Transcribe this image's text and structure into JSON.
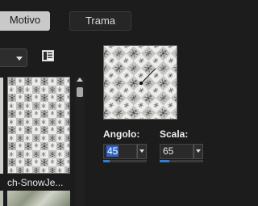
{
  "tabs": [
    {
      "label": "Motivo",
      "active": true
    },
    {
      "label": "Trama",
      "active": false
    }
  ],
  "icons": {
    "dropdown_caret": "chevron-down-icon",
    "view_toggle": "list-view-icon",
    "scroll_up": "arrow-up-icon",
    "spin_buttons": "spin-dropdown-icon"
  },
  "library": {
    "selected_item_label": "ch-SnowJe...",
    "dropdown_value": ""
  },
  "preview": {
    "angle_indicator": "direction-line"
  },
  "params": {
    "angle": {
      "label": "Angolo:",
      "value": "45"
    },
    "scale": {
      "label": "Scala:",
      "value": "65"
    }
  },
  "colors": {
    "accent": "#2f64c6",
    "slider": "#2f7fd6",
    "background": "#1c1c1c"
  }
}
